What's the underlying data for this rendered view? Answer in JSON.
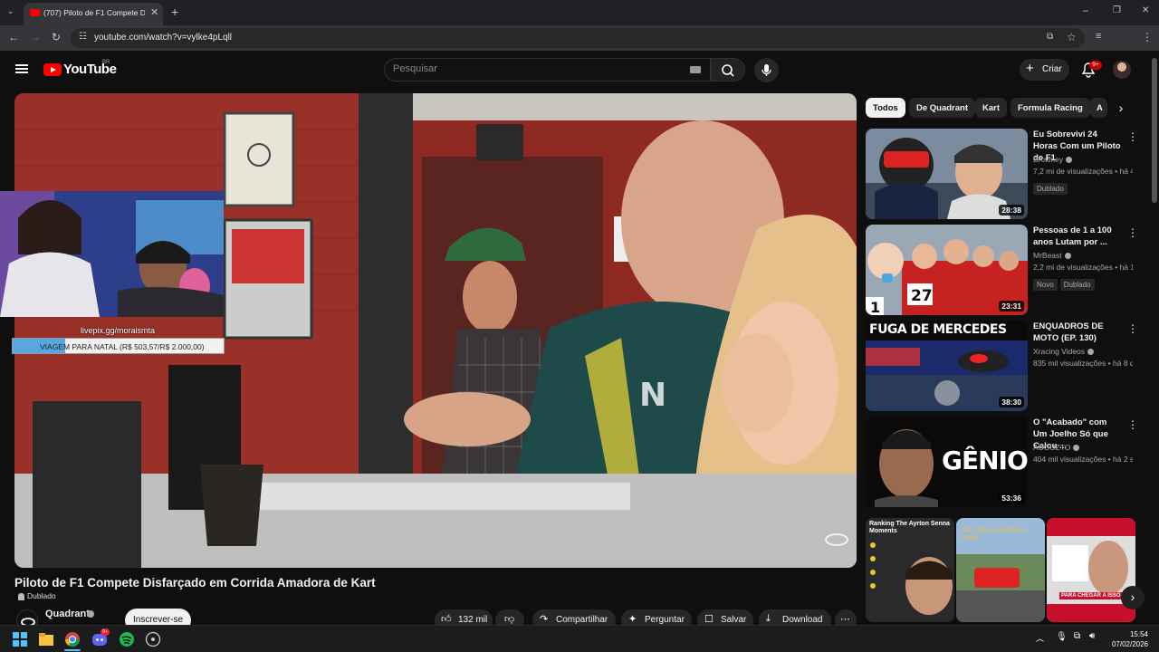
{
  "browser": {
    "tab_title": "(707) Piloto de F1 Compete Disfarçado",
    "tab_close": "✕",
    "new_tab": "+",
    "url": "youtube.com/watch?v=vylke4pLqll"
  },
  "header": {
    "logo": "YouTube",
    "region": "BR",
    "search_placeholder": "Pesquisar",
    "create_label": "Criar",
    "notifications_badge": "9+"
  },
  "overlay": {
    "donation_url": "livepix.gg/moraismta",
    "donation_text": "VIAGEM PARA NATAL (R$ 503,57/R$ 2.000,00)",
    "donation_progress": 0.25
  },
  "video": {
    "title": "Piloto de F1 Compete Disfarçado em Corrida Amadora de Kart",
    "dub_badge": "Dublado",
    "channel": "Quadrant",
    "subscribe": "Inscrever-se",
    "likes": "132 mil",
    "share": "Compartilhar",
    "ask": "Perguntar",
    "save": "Salvar",
    "download": "Download"
  },
  "chips": [
    "Todos",
    "De Quadrant",
    "Kart",
    "Formula Racing",
    "A"
  ],
  "recommendations": [
    {
      "title": "Eu Sobrevivi 24 Horas Com um Piloto de F1",
      "channel": "Browney",
      "views": "7,2 mi de visualizações • há 4 ...",
      "duration": "28:38",
      "badges": [
        "Dublado"
      ]
    },
    {
      "title": "Pessoas de 1 a 100 anos Lutam por ...",
      "channel": "MrBeast",
      "views": "2,2 mi de visualizações • há 1 ...",
      "duration": "23:31",
      "badges": [
        "Novo",
        "Dublado"
      ]
    },
    {
      "title": "ENQUADROS DE MOTO (EP. 130)",
      "channel": "Xracing Videos",
      "views": "835 mil visualizações • há 8 di...",
      "duration": "38:30",
      "badges": []
    },
    {
      "title": "O \"Acabado\" com Um Joelho Só que Calou ...",
      "channel": "AUGUZTO",
      "views": "404 mil visualizações • há 2 s...",
      "duration": "53:36",
      "badges": []
    }
  ],
  "thumb_text": {
    "fuga": "FUGA DE MERCEDES",
    "genio": "GÊNIO"
  },
  "shorts": [
    {
      "caption": "Ranking The Ayrton Senna Moments"
    },
    {
      "caption": "Vai, hoje eu conheço a inveja"
    },
    {
      "caption": "PARA CHEGAR A ISSO"
    }
  ],
  "taskbar": {
    "time": "15:54",
    "date": "07/02/2026"
  }
}
